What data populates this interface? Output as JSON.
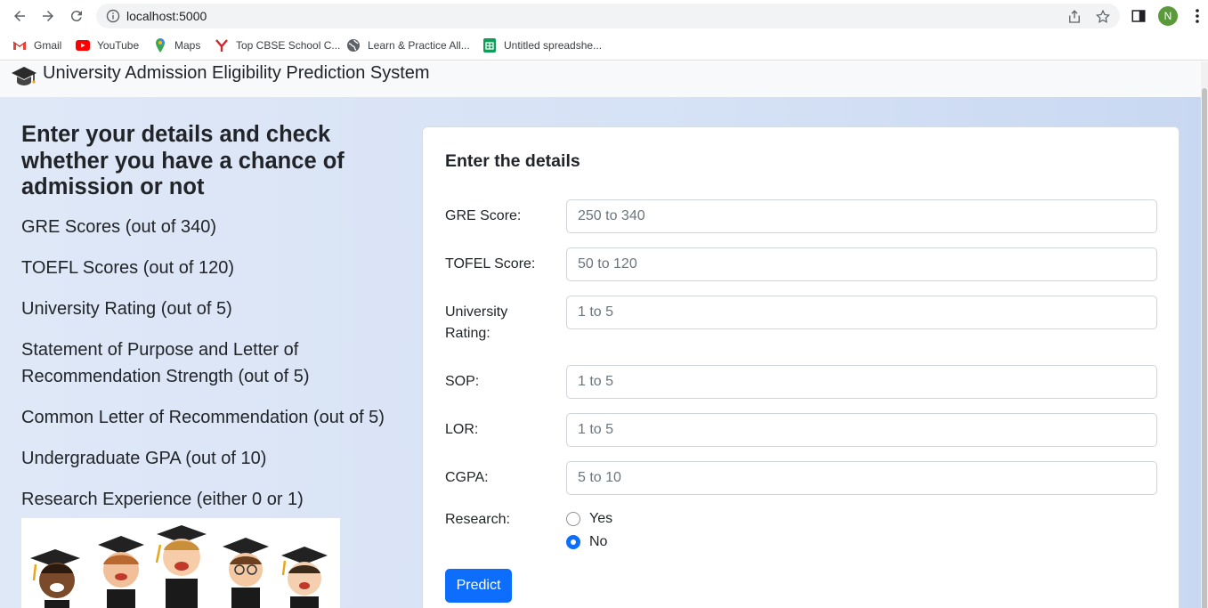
{
  "browser": {
    "url": "localhost:5000",
    "avatar_letter": "N",
    "bookmarks": [
      {
        "label": "Gmail",
        "icon": "gmail-icon"
      },
      {
        "label": "YouTube",
        "icon": "youtube-icon"
      },
      {
        "label": "Maps",
        "icon": "maps-icon"
      },
      {
        "label": "Top CBSE School C...",
        "icon": "school-icon"
      },
      {
        "label": "Learn & Practice All...",
        "icon": "globe-icon"
      },
      {
        "label": "Untitled spreadshe...",
        "icon": "sheets-icon"
      }
    ]
  },
  "app": {
    "title": "University Admission Eligibility Prediction System",
    "logo_icon": "graduation-cap-icon"
  },
  "intro": {
    "heading": "Enter your details and check whether you have a chance of admission or not",
    "items": [
      "GRE Scores (out of 340)",
      "TOEFL Scores (out of 120)",
      "University Rating (out of 5)",
      "Statement of Purpose and Letter of Recommendation Strength (out of 5)",
      "Common Letter of Recommendation (out of 5)",
      "Undergraduate GPA (out of 10)",
      "Research Experience (either 0 or 1)"
    ]
  },
  "form": {
    "title": "Enter the details",
    "fields": [
      {
        "label": "GRE Score:",
        "placeholder": "250 to 340",
        "value": ""
      },
      {
        "label": "TOFEL Score:",
        "placeholder": "50 to 120",
        "value": ""
      },
      {
        "label": "University Rating:",
        "placeholder": "1 to 5",
        "value": ""
      },
      {
        "label": "SOP:",
        "placeholder": "1 to 5",
        "value": ""
      },
      {
        "label": "LOR:",
        "placeholder": "1 to 5",
        "value": ""
      },
      {
        "label": "CGPA:",
        "placeholder": "5 to 10",
        "value": ""
      }
    ],
    "research": {
      "label": "Research:",
      "options": [
        "Yes",
        "No"
      ],
      "selected": "No"
    },
    "submit_label": "Predict"
  },
  "colors": {
    "primary": "#0d6efd",
    "page_bg": "#d5e1f5",
    "navbar_bg": "#f8f9fa"
  }
}
